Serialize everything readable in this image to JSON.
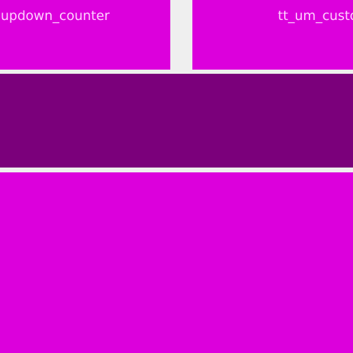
{
  "colors": {
    "background": "#efefef",
    "tile": "#dc00dc",
    "tile_dark": "#7b007b",
    "label": "#ffd2ff"
  },
  "tiles": {
    "updown_counter": {
      "label": "updown_counter"
    },
    "custom": {
      "label": "tt_um_custo"
    }
  }
}
